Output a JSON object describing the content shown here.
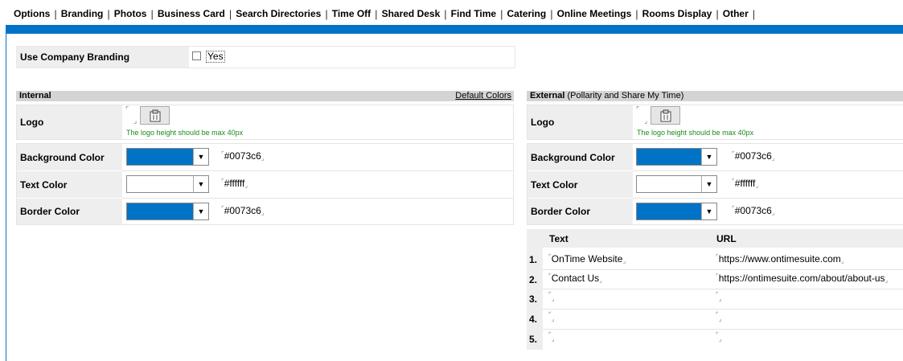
{
  "tabs": [
    "Options",
    "Branding",
    "Photos",
    "Business Card",
    "Search Directories",
    "Time Off",
    "Shared Desk",
    "Find Time",
    "Catering",
    "Online Meetings",
    "Rooms Display",
    "Other"
  ],
  "accent": "#0073c6",
  "use_branding": {
    "label": "Use Company Branding",
    "checkbox_label": "Yes",
    "checked": false
  },
  "internal": {
    "header": "Internal",
    "default_colors": "Default Colors",
    "logo_label": "Logo",
    "logo_hint": "The logo height should be max 40px",
    "colors": [
      {
        "label": "Background Color",
        "value": "#0073c6",
        "swatch": "#0073c6"
      },
      {
        "label": "Text Color",
        "value": "#ffffff",
        "swatch": "#ffffff"
      },
      {
        "label": "Border Color",
        "value": "#0073c6",
        "swatch": "#0073c6"
      }
    ]
  },
  "external": {
    "header_bold": "External",
    "header_rest": "(Pollarity and Share My Time)",
    "logo_label": "Logo",
    "logo_hint": "The logo height should be max 40px",
    "colors": [
      {
        "label": "Background Color",
        "value": "#0073c6",
        "swatch": "#0073c6"
      },
      {
        "label": "Text Color",
        "value": "#ffffff",
        "swatch": "#ffffff"
      },
      {
        "label": "Border Color",
        "value": "#0073c6",
        "swatch": "#0073c6"
      }
    ],
    "links_header": {
      "text": "Text",
      "url": "URL"
    },
    "links": [
      {
        "num": "1.",
        "text": "OnTime Website",
        "url": "https://www.ontimesuite.com"
      },
      {
        "num": "2.",
        "text": "Contact Us",
        "url": "https://ontimesuite.com/about/about-us"
      },
      {
        "num": "3.",
        "text": "",
        "url": ""
      },
      {
        "num": "4.",
        "text": "",
        "url": ""
      },
      {
        "num": "5.",
        "text": "",
        "url": ""
      }
    ]
  }
}
